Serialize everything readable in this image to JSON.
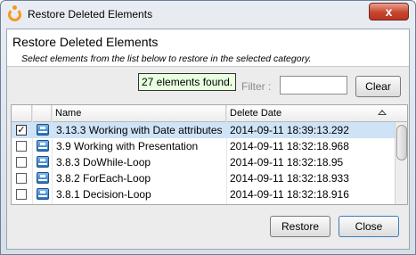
{
  "window": {
    "title": "Restore Deleted Elements",
    "close_symbol": "x"
  },
  "header": {
    "title": "Restore Deleted Elements",
    "subtitle": "Select elements from the list below to restore in the selected category."
  },
  "filter": {
    "label": "Filter :",
    "value": "",
    "tooltip": "27 elements found.",
    "clear_label": "Clear"
  },
  "table": {
    "columns": [
      "Name",
      "Delete Date"
    ],
    "rows": [
      {
        "checked": true,
        "selected": true,
        "name": "3.13.3 Working with Date attributes",
        "date": "2014-09-11 18:39:13.292"
      },
      {
        "checked": false,
        "selected": false,
        "name": "3.9 Working with Presentation",
        "date": "2014-09-11 18:32:18.968"
      },
      {
        "checked": false,
        "selected": false,
        "name": "3.8.3 DoWhile-Loop",
        "date": "2014-09-11 18:32:18.95"
      },
      {
        "checked": false,
        "selected": false,
        "name": "3.8.2 ForEach-Loop",
        "date": "2014-09-11 18:32:18.933"
      },
      {
        "checked": false,
        "selected": false,
        "name": "3.8.1 Decision-Loop",
        "date": "2014-09-11 18:32:18.916"
      }
    ],
    "check_mark": "✓"
  },
  "buttons": {
    "restore": "Restore",
    "close": "Close"
  }
}
